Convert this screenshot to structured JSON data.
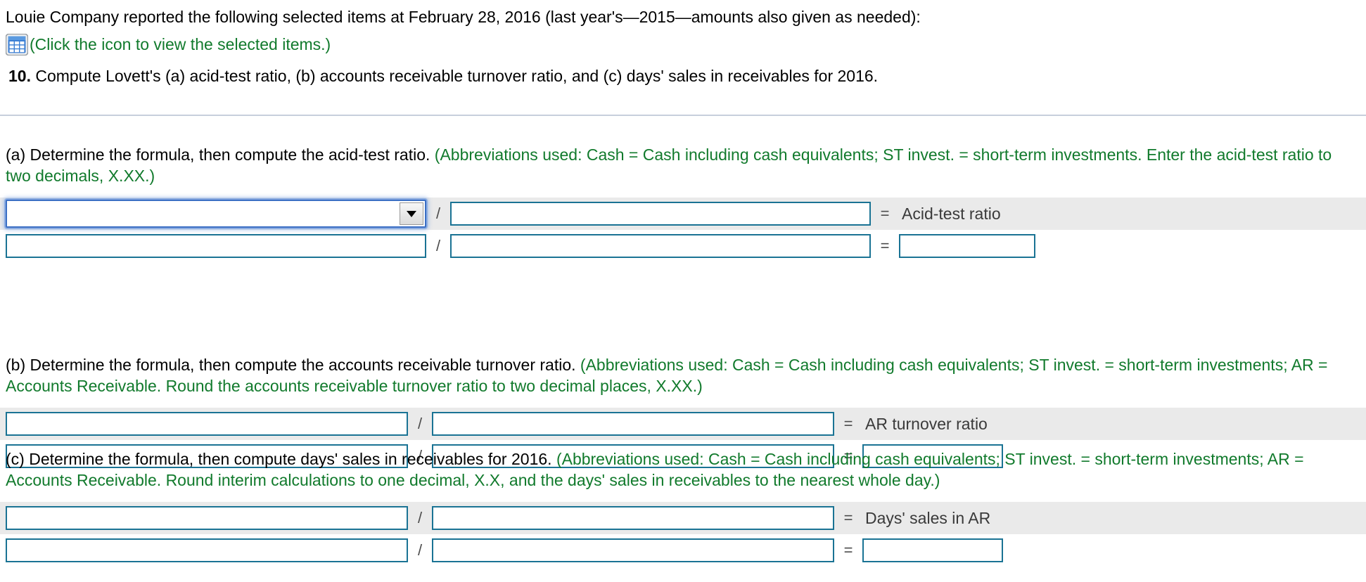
{
  "header": {
    "intro": "Louie Company reported the following selected items at February 28, 2016 (last year's—2015—amounts also given as needed):",
    "icon_name": "spreadsheet-grid-icon",
    "icon_caption": "(Click the icon to view the selected items.)",
    "question_number": "10.",
    "question_text": "Compute Lovett's (a) acid-test ratio, (b) accounts receivable turnover ratio, and (c) days' sales in receivables for 2016."
  },
  "parts": {
    "a": {
      "prompt_black": "(a) Determine the formula, then compute the acid-test ratio.",
      "prompt_green": "(Abbreviations used: Cash = Cash including cash equivalents; ST invest. = short-term investments. Enter the acid-test ratio to two decimals, X.XX.)",
      "divider_symbol": "/",
      "equals_symbol": "=",
      "result_label": "Acid-test ratio",
      "numerator_value": "",
      "denominator_value": "",
      "numerator2_value": "",
      "denominator2_value": "",
      "result_value": "",
      "dropdown_selected": "",
      "dropdown_arrow": "▼"
    },
    "b": {
      "prompt_black": "(b) Determine the formula, then compute the accounts receivable turnover ratio.",
      "prompt_green": "(Abbreviations used: Cash = Cash including cash equivalents; ST invest. = short-term investments; AR = Accounts Receivable. Round the accounts receivable turnover ratio to two decimal places, X.XX.)",
      "divider_symbol": "/",
      "equals_symbol": "=",
      "result_label": "AR turnover ratio",
      "numerator_value": "",
      "denominator_value": "",
      "numerator2_value": "",
      "denominator2_value": "",
      "result_value": ""
    },
    "c": {
      "prompt_black": "(c) Determine the formula, then compute days' sales in receivables for 2016.",
      "prompt_green": "(Abbreviations used: Cash = Cash including cash equivalents; ST invest. = short-term investments; AR = Accounts Receivable. Round interim calculations to one decimal, X.X, and the days' sales in receivables to the nearest whole day.)",
      "divider_symbol": "/",
      "equals_symbol": "=",
      "result_label": "Days' sales in AR",
      "numerator_value": "",
      "denominator_value": "",
      "numerator2_value": "",
      "denominator2_value": "",
      "result_value": ""
    }
  },
  "colors": {
    "hint_green": "#117a2c",
    "field_border_teal": "#1a7394",
    "focus_blue": "#3b6fc4",
    "row_shade": "#eaeaea",
    "divider": "#c7cfdc"
  }
}
